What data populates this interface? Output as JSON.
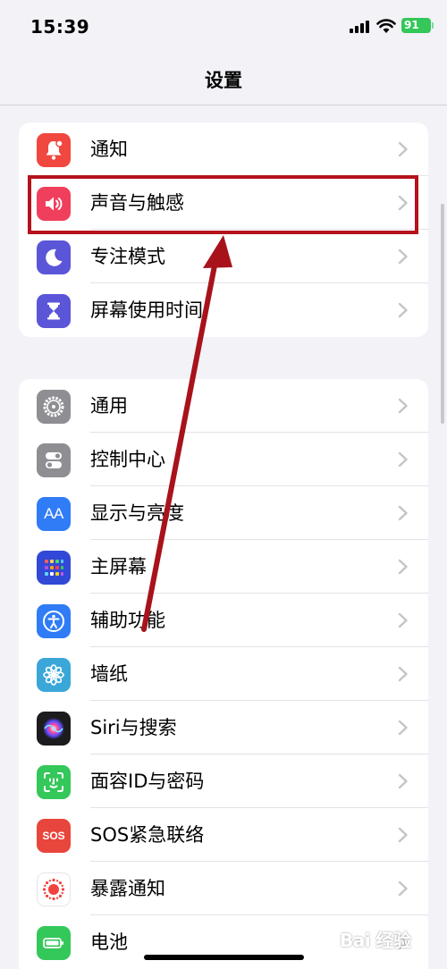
{
  "status_bar": {
    "time": "15:39",
    "battery": "91"
  },
  "nav": {
    "title": "设置"
  },
  "groups": [
    {
      "items": [
        {
          "label": "通知",
          "icon": "notifications-icon",
          "color": "#f0473e"
        },
        {
          "label": "声音与触感",
          "icon": "sound-icon",
          "color": "#ef3f5c"
        },
        {
          "label": "专注模式",
          "icon": "moon-icon",
          "color": "#5b55d8"
        },
        {
          "label": "屏幕使用时间",
          "icon": "hourglass-icon",
          "color": "#5b55d8"
        }
      ]
    },
    {
      "items": [
        {
          "label": "通用",
          "icon": "gear-icon",
          "color": "#8e8e93"
        },
        {
          "label": "控制中心",
          "icon": "toggle-icon",
          "color": "#8e8e93"
        },
        {
          "label": "显示与亮度",
          "icon": "aa-icon",
          "color": "#2f7cf6"
        },
        {
          "label": "主屏幕",
          "icon": "home-grid-icon",
          "color": "#3248d6"
        },
        {
          "label": "辅助功能",
          "icon": "accessibility-icon",
          "color": "#2f7cf6"
        },
        {
          "label": "墙纸",
          "icon": "flower-icon",
          "color": "#3aa7d8"
        },
        {
          "label": "Siri与搜索",
          "icon": "siri-icon",
          "color": "#1c1c1e"
        },
        {
          "label": "面容ID与密码",
          "icon": "face-id-icon",
          "color": "#34c759"
        },
        {
          "label": "SOS紧急联络",
          "icon": "sos-icon",
          "color": "#e8453c"
        },
        {
          "label": "暴露通知",
          "icon": "exposure-icon",
          "color": "#ffffff"
        },
        {
          "label": "电池",
          "icon": "battery-icon",
          "color": "#34c759"
        }
      ]
    }
  ],
  "icon_text": {
    "aa": "AA",
    "sos": "SOS"
  },
  "watermark": "Bai 经验",
  "colors": {
    "highlight": "#b5121b",
    "background": "#f2f2f7"
  }
}
